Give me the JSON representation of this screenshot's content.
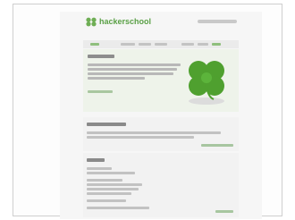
{
  "site": {
    "logo_text": "hackerschool"
  },
  "colors": {
    "brand_green": "#5aa046",
    "hero_background": "#eef3ea",
    "page_background": "#f6f6f6"
  },
  "icons": {
    "logo": "clover-icon",
    "hero_graphic": "clover-icon"
  }
}
